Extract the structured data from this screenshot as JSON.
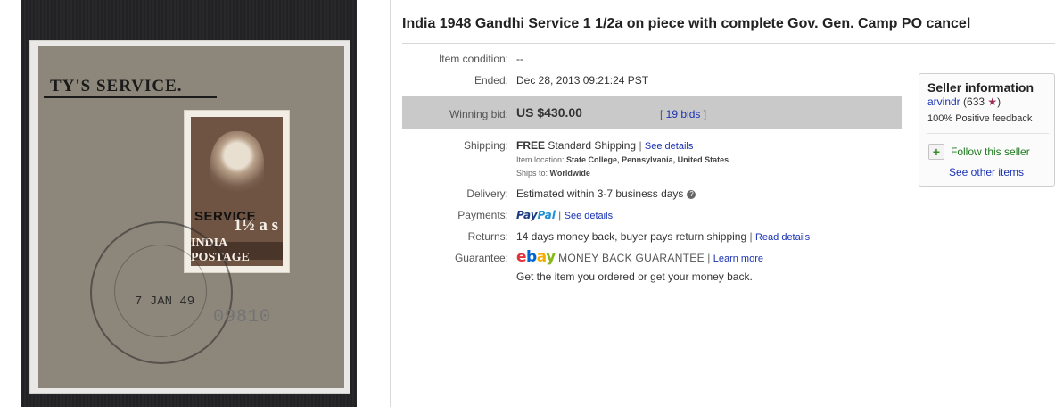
{
  "photo": {
    "paper_text": "TY'S SERVICE.",
    "stamp_overprint": "SERVICE",
    "stamp_country": "INDIA POSTAGE",
    "stamp_value": "1½ a s",
    "postmark_date": "7 JAN 49",
    "serial": "09810"
  },
  "title": "India 1948 Gandhi Service 1 1/2a on piece with complete Gov. Gen. Camp PO cancel",
  "item_condition": {
    "label": "Item condition:",
    "value": "--"
  },
  "ended": {
    "label": "Ended:",
    "value": "Dec 28, 2013  09:21:24 PST"
  },
  "winning_bid": {
    "label": "Winning bid:",
    "value": "US $430.00",
    "bids_prefix": "[ ",
    "bids": "19 bids",
    "bids_suffix": " ]"
  },
  "shipping": {
    "label": "Shipping:",
    "free": "FREE",
    "method": "Standard Shipping",
    "sep": "|",
    "details_link": "See details",
    "location_label": "Item location:",
    "location": "State College, Pennsylvania, United States",
    "ships_label": "Ships to:",
    "ships_to": "Worldwide"
  },
  "delivery": {
    "label": "Delivery:",
    "value": "Estimated within 3-7 business days",
    "icon": "?"
  },
  "payments": {
    "label": "Payments:",
    "paypal_1": "Pay",
    "paypal_2": "Pal",
    "sep": "|",
    "link": "See details"
  },
  "returns": {
    "label": "Returns:",
    "value": "14 days money back, buyer pays return shipping",
    "sep": "|",
    "link": "Read details"
  },
  "guarantee": {
    "label": "Guarantee:",
    "ebay": [
      "e",
      "b",
      "a",
      "y"
    ],
    "mbg": "MONEY BACK GUARANTEE",
    "sep": "|",
    "link": "Learn more",
    "note": "Get the item you ordered or get your money back."
  },
  "seller": {
    "title": "Seller information",
    "name": "arvindr",
    "score_prefix": " (633 ",
    "star": "★",
    "score_suffix": ")",
    "feedback": "100% Positive feedback",
    "follow_icon": "+",
    "follow": "Follow this seller",
    "other_items": "See other items"
  },
  "colors": {
    "gray_band": "#c9c9c9",
    "link": "#1a33b3",
    "follow_green": "#1f7a1f"
  }
}
